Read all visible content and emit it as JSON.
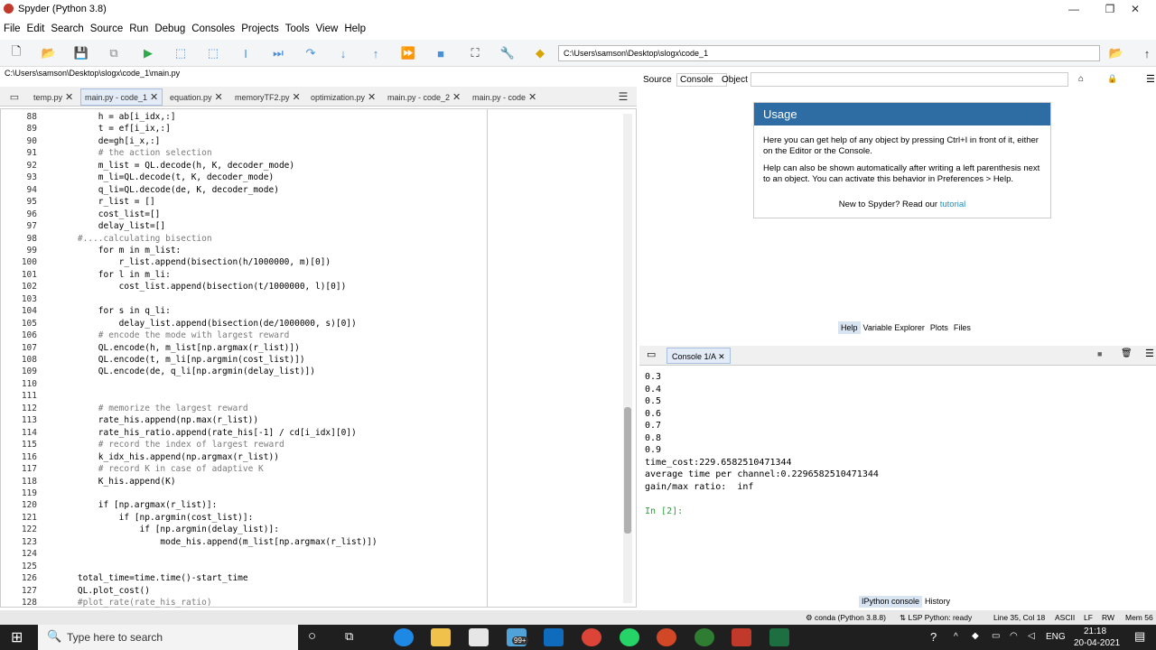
{
  "window": {
    "title": "Spyder (Python 3.8)",
    "minimize": "—",
    "maximize": "❐",
    "close": "✕"
  },
  "menu": [
    "File",
    "Edit",
    "Search",
    "Source",
    "Run",
    "Debug",
    "Consoles",
    "Projects",
    "Tools",
    "View",
    "Help"
  ],
  "toolbar": {
    "path": "C:\\Users\\samson\\Desktop\\slogx\\code_1"
  },
  "editor": {
    "file_path": "C:\\Users\\samson\\Desktop\\slogx\\code_1\\main.py",
    "tabs": [
      "temp.py",
      "main.py - code_1",
      "equation.py",
      "memoryTF2.py",
      "optimization.py",
      "main.py - code_2",
      "main.py - code"
    ],
    "active_tab": 1,
    "lines": [
      {
        "n": "88",
        "t": "        h = ab[i_idx,:]"
      },
      {
        "n": "89",
        "t": "        t = ef[i_ix,:]"
      },
      {
        "n": "90",
        "t": "        de=gh[i_x,:]"
      },
      {
        "n": "91",
        "t": "        # the action selection"
      },
      {
        "n": "92",
        "t": "        m_list = QL.decode(h, K, decoder_mode)"
      },
      {
        "n": "93",
        "t": "        m_li=QL.decode(t, K, decoder_mode)"
      },
      {
        "n": "94",
        "t": "        q_li=QL.decode(de, K, decoder_mode)"
      },
      {
        "n": "95",
        "t": "        r_list = []"
      },
      {
        "n": "96",
        "t": "        cost_list=[]"
      },
      {
        "n": "97",
        "t": "        delay_list=[]"
      },
      {
        "n": "98",
        "t": "    #....calculating bisection"
      },
      {
        "n": "99",
        "t": "        for m in m_list:"
      },
      {
        "n": "100",
        "t": "            r_list.append(bisection(h/1000000, m)[0])"
      },
      {
        "n": "101",
        "t": "        for l in m_li:"
      },
      {
        "n": "102",
        "t": "            cost_list.append(bisection(t/1000000, l)[0])"
      },
      {
        "n": "103",
        "t": ""
      },
      {
        "n": "104",
        "t": "        for s in q_li:"
      },
      {
        "n": "105",
        "t": "            delay_list.append(bisection(de/1000000, s)[0])"
      },
      {
        "n": "106",
        "t": "        # encode the mode with largest reward"
      },
      {
        "n": "107",
        "t": "        QL.encode(h, m_list[np.argmax(r_list)])"
      },
      {
        "n": "108",
        "t": "        QL.encode(t, m_li[np.argmin(cost_list)])"
      },
      {
        "n": "109",
        "t": "        QL.encode(de, q_li[np.argmin(delay_list)])"
      },
      {
        "n": "110",
        "t": ""
      },
      {
        "n": "111",
        "t": ""
      },
      {
        "n": "112",
        "t": "        # memorize the largest reward"
      },
      {
        "n": "113",
        "t": "        rate_his.append(np.max(r_list))"
      },
      {
        "n": "114",
        "t": "        rate_his_ratio.append(rate_his[-1] / cd[i_idx][0])"
      },
      {
        "n": "115",
        "t": "        # record the index of largest reward"
      },
      {
        "n": "116",
        "t": "        k_idx_his.append(np.argmax(r_list))"
      },
      {
        "n": "117",
        "t": "        # record K in case of adaptive K"
      },
      {
        "n": "118",
        "t": "        K_his.append(K)"
      },
      {
        "n": "119",
        "t": ""
      },
      {
        "n": "120",
        "t": "        if [np.argmax(r_list)]:"
      },
      {
        "n": "121",
        "t": "            if [np.argmin(cost_list)]:"
      },
      {
        "n": "122",
        "t": "                if [np.argmin(delay_list)]:"
      },
      {
        "n": "123",
        "t": "                    mode_his.append(m_list[np.argmax(r_list)])"
      },
      {
        "n": "124",
        "t": ""
      },
      {
        "n": "125",
        "t": ""
      },
      {
        "n": "126",
        "t": "    total_time=time.time()-start_time"
      },
      {
        "n": "127",
        "t": "    QL.plot_cost()"
      },
      {
        "n": "128",
        "t": "    #plot_rate(rate_his_ratio)"
      }
    ]
  },
  "help": {
    "source_label": "Source",
    "source_value": "Console",
    "object_label": "Object",
    "usage_title": "Usage",
    "usage_p1": "Here you can get help of any object by pressing Ctrl+I in front of it, either on the Editor or the Console.",
    "usage_p2": "Help can also be shown automatically after writing a left parenthesis next to an object. You can activate this behavior in Preferences > Help.",
    "usage_foot": "New to Spyder? Read our",
    "usage_link": "tutorial",
    "tabs": [
      "Help",
      "Variable Explorer",
      "Plots",
      "Files"
    ]
  },
  "console": {
    "tab": "Console 1/A",
    "lines": [
      "0.3",
      "0.4",
      "0.5",
      "0.6",
      "0.7",
      "0.8",
      "0.9",
      "time_cost:229.6582510471344",
      "average time per channel:0.2296582510471344",
      "gain/max ratio:  inf",
      "",
      "In [2]:"
    ],
    "tabs": [
      "IPython console",
      "History"
    ]
  },
  "status": {
    "conda": "conda (Python 3.8.8)",
    "lsp": "LSP Python: ready",
    "pos": "Line 35, Col 18",
    "enc": "ASCII",
    "eol": "LF",
    "rw": "RW",
    "mem": "Mem 56"
  },
  "taskbar": {
    "search_placeholder": "Type here to search",
    "badge": "99+",
    "lang": "ENG",
    "time": "21:18",
    "date": "20-04-2021"
  }
}
